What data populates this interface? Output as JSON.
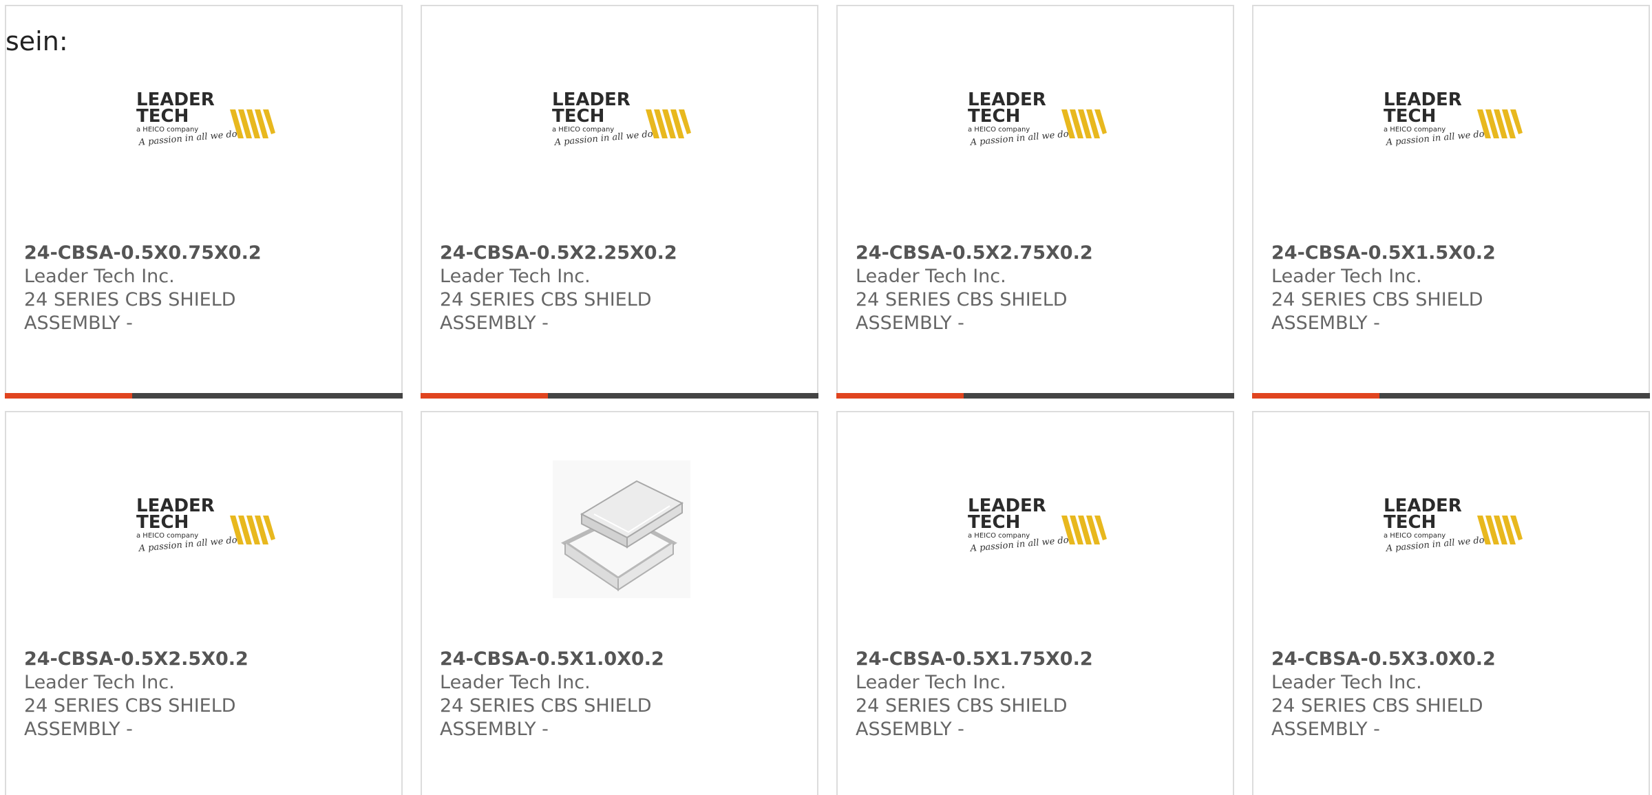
{
  "intro_text": "sein:",
  "logo": {
    "line1": "LEADER",
    "line2": "TECH",
    "line3": "a HEICO company",
    "tagline": "A passion in all we do"
  },
  "colors": {
    "accent": "#e0441f",
    "bar_dark": "#444444",
    "logo_yellow": "#e8b81e"
  },
  "products": [
    {
      "part_number": "24-CBSA-0.5X0.75X0.2",
      "manufacturer": "Leader Tech Inc.",
      "description": "24 SERIES CBS SHIELD ASSEMBLY -",
      "image": "leader-tech-logo"
    },
    {
      "part_number": "24-CBSA-0.5X2.25X0.2",
      "manufacturer": "Leader Tech Inc.",
      "description": "24 SERIES CBS SHIELD ASSEMBLY -",
      "image": "leader-tech-logo"
    },
    {
      "part_number": "24-CBSA-0.5X2.75X0.2",
      "manufacturer": "Leader Tech Inc.",
      "description": "24 SERIES CBS SHIELD ASSEMBLY -",
      "image": "leader-tech-logo"
    },
    {
      "part_number": "24-CBSA-0.5X1.5X0.2",
      "manufacturer": "Leader Tech Inc.",
      "description": "24 SERIES CBS SHIELD ASSEMBLY -",
      "image": "leader-tech-logo"
    },
    {
      "part_number": "24-CBSA-0.5X2.5X0.2",
      "manufacturer": "Leader Tech Inc.",
      "description": "24 SERIES CBS SHIELD ASSEMBLY -",
      "image": "leader-tech-logo"
    },
    {
      "part_number": "24-CBSA-0.5X1.0X0.2",
      "manufacturer": "Leader Tech Inc.",
      "description": "24 SERIES CBS SHIELD ASSEMBLY -",
      "image": "shield-product-photo"
    },
    {
      "part_number": "24-CBSA-0.5X1.75X0.2",
      "manufacturer": "Leader Tech Inc.",
      "description": "24 SERIES CBS SHIELD ASSEMBLY -",
      "image": "leader-tech-logo"
    },
    {
      "part_number": "24-CBSA-0.5X3.0X0.2",
      "manufacturer": "Leader Tech Inc.",
      "description": "24 SERIES CBS SHIELD ASSEMBLY -",
      "image": "leader-tech-logo"
    }
  ]
}
